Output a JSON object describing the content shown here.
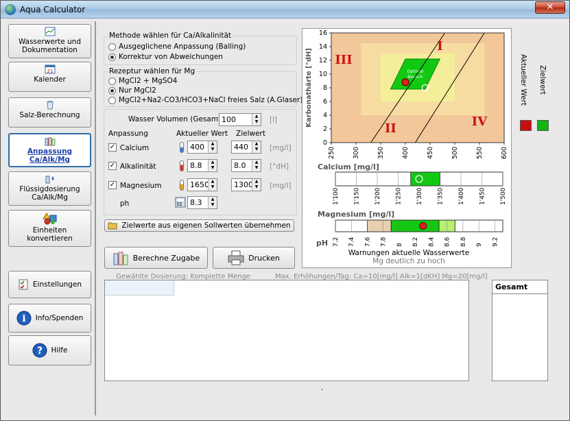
{
  "window": {
    "title": "Aqua Calculator",
    "close_glyph": "✕"
  },
  "sidebar": {
    "items": [
      {
        "label": "Wasserwerte und Dokumentation",
        "icon": "chart-icon"
      },
      {
        "label": "Kalender",
        "icon": "calendar-icon",
        "badge": "21"
      },
      {
        "label": "Salz-Berechnung",
        "icon": "salt-icon"
      },
      {
        "label": "Anpassung Ca/Alk/Mg",
        "icon": "bottles-icon"
      },
      {
        "label": "Flüssigdosierung Ca/Alk/Mg",
        "icon": "dosing-icon"
      },
      {
        "label": "Einheiten konvertieren",
        "icon": "shapes-icon"
      }
    ],
    "bottom_items": [
      {
        "label": "Einstellungen",
        "icon": "checklist-icon"
      },
      {
        "label": "Info/Spenden",
        "icon": "info-icon"
      },
      {
        "label": "Hilfe",
        "icon": "help-icon"
      }
    ]
  },
  "method": {
    "title": "Methode wählen für Ca/Alkalinität",
    "options": [
      "Ausgeglichene Anpassung (Balling)",
      "Korrektur von Abweichungen"
    ],
    "selected": 1
  },
  "recipe": {
    "title": "Rezeptur wählen für Mg",
    "options": [
      "MgCl2 + MgSO4",
      "Nur MgCl2",
      "MgCl2+Na2-CO3/HCO3+NaCl freies Salz (A.Glaser)"
    ],
    "selected": 1
  },
  "volume": {
    "label": "Wasser Volumen (Gesamt)",
    "value": "100",
    "unit": "[l]"
  },
  "params": {
    "header_adjust": "Anpassung",
    "header_current": "Aktueller Wert",
    "header_target": "Zielwert",
    "rows": [
      {
        "name": "Calcium",
        "checked": true,
        "current": "400",
        "target": "440",
        "unit": "[mg/l]",
        "thermo_color": "#3a7bd5"
      },
      {
        "name": "Alkalinität",
        "checked": true,
        "current": "8.8",
        "target": "8.0",
        "unit": "[°dH]",
        "thermo_color": "#d93a2a"
      },
      {
        "name": "Magnesium",
        "checked": true,
        "current": "1650",
        "target": "1300",
        "unit": "[mg/l]",
        "thermo_color": "#e6a020"
      }
    ],
    "ph_label": "ph",
    "ph_value": "8.3"
  },
  "apply_button": "Zielwerte aus eigenen Sollwerten übernehmen",
  "calc_button": "Berechne Zugabe",
  "print_button": "Drucken",
  "chart_data": [
    {
      "type": "scatter",
      "title": "",
      "xlabel": "Calcium [mg/l]",
      "ylabel": "Karbonathärte [°dH]",
      "x_ticks": [
        "250",
        "300",
        "350",
        "400",
        "450",
        "500",
        "550",
        "600"
      ],
      "y_ticks": [
        "0",
        "2",
        "4",
        "6",
        "8",
        "10",
        "12",
        "14",
        "16"
      ],
      "xlim": [
        250,
        600
      ],
      "ylim": [
        0,
        16
      ],
      "regions": [
        "I",
        "II",
        "III",
        "IV"
      ],
      "optimum_label_1": "Optimal",
      "optimum_label_2": "Bereich",
      "optimum_polygon": [
        [
          370,
          7.8
        ],
        [
          440,
          7.8
        ],
        [
          470,
          12.2
        ],
        [
          400,
          12.2
        ]
      ],
      "boundary_lines": [
        [
          [
            330,
            0
          ],
          [
            480,
            16
          ]
        ],
        [
          [
            420,
            0
          ],
          [
            560,
            16
          ]
        ]
      ],
      "points": [
        {
          "name": "Aktueller Wert",
          "x": 400,
          "y": 8.8,
          "color": "#e02020"
        },
        {
          "name": "Zielwert",
          "x": 440,
          "y": 8.0,
          "color": "#20c020"
        }
      ]
    },
    {
      "type": "bar",
      "title": "Magnesium [mg/l]",
      "ticks": [
        "1'100",
        "1'150",
        "1'200",
        "1'250",
        "1'300",
        "1'350",
        "1'400",
        "1'450",
        "1'500"
      ],
      "xlim": [
        1100,
        1500
      ],
      "green_range": [
        1280,
        1350
      ],
      "target": 1300
    },
    {
      "type": "bar",
      "title": "pH",
      "ticks": [
        "7.2",
        "7.4",
        "7.6",
        "7.8",
        "8",
        "8.2",
        "8.4",
        "8.6",
        "8.8",
        "9",
        "9.2"
      ],
      "xlim": [
        7.2,
        9.3
      ],
      "tan_range": [
        7.6,
        7.9
      ],
      "green_range": [
        7.9,
        8.5
      ],
      "lightgreen_range": [
        8.5,
        8.7
      ],
      "current": 8.3
    }
  ],
  "legend": {
    "current_label": "Aktueller Wert",
    "target_label": "Zielwert",
    "current_color": "#cc1010",
    "target_color": "#10b010"
  },
  "warnings": {
    "title": "Warnungen aktuelle Wasserwerte",
    "text": "Mg deutlich zu hoch"
  },
  "dosing": {
    "label": "Gewählte Dosierung:  Komplette Menge",
    "max_label": "Max. Erhöhungen/Tag: Ca=10[mg/l] Alk=1[dKH] Mg=20[mg/l]"
  },
  "total_header": "Gesamt",
  "footer_dot": "."
}
